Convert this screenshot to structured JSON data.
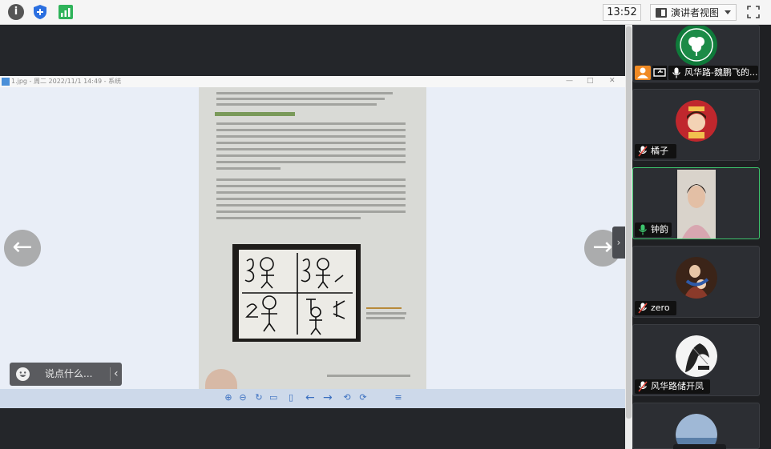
{
  "topbar": {
    "info_icon_glyph": "i",
    "clock": "13:52",
    "presenter_view_label": "演讲者视图"
  },
  "viewer": {
    "title": "1.jpg - 周二 2022/11/1 14:49 - 系统",
    "controls": {
      "minimize": "—",
      "maximize": "□",
      "close": "✕"
    },
    "toolbar_glyphs": [
      "⊕",
      "⊖",
      "↻",
      "▭",
      "▯",
      "←",
      "→",
      "⟲",
      "⟳",
      "≡"
    ]
  },
  "navigation": {
    "prev": "←",
    "next": "→",
    "panel_toggle": "›"
  },
  "chat": {
    "placeholder": "说点什么...",
    "collapse": "‹"
  },
  "participants": [
    {
      "name": "风华路-魏鹏飞的..."
    },
    {
      "name": "橘子"
    },
    {
      "name": "钟韵"
    },
    {
      "name": "zero"
    },
    {
      "name": "风华路储开凤"
    }
  ],
  "colors": {
    "accent_green": "#3dc46d",
    "host_orange": "#f08a24",
    "mic_muted_red": "#e0453a"
  }
}
